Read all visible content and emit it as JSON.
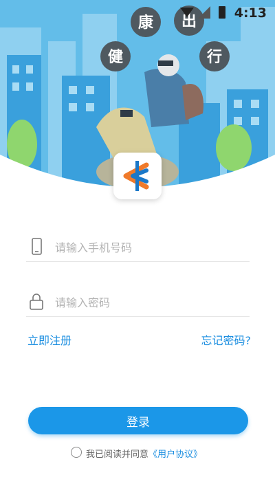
{
  "status_bar": {
    "time": "4:13"
  },
  "hero": {
    "bubbles": [
      "康",
      "出",
      "健",
      "行"
    ]
  },
  "login": {
    "phone_placeholder": "请输入手机号码",
    "password_placeholder": "请输入密码",
    "register_label": "立即注册",
    "forgot_label": "忘记密码?",
    "login_button": "登录",
    "agree_prefix": "我已阅读并同意",
    "agreement_link": "《用户协议》"
  },
  "colors": {
    "accent": "#1b97e8",
    "sky": "#5bb7e8",
    "building": "#3aa0dc"
  }
}
